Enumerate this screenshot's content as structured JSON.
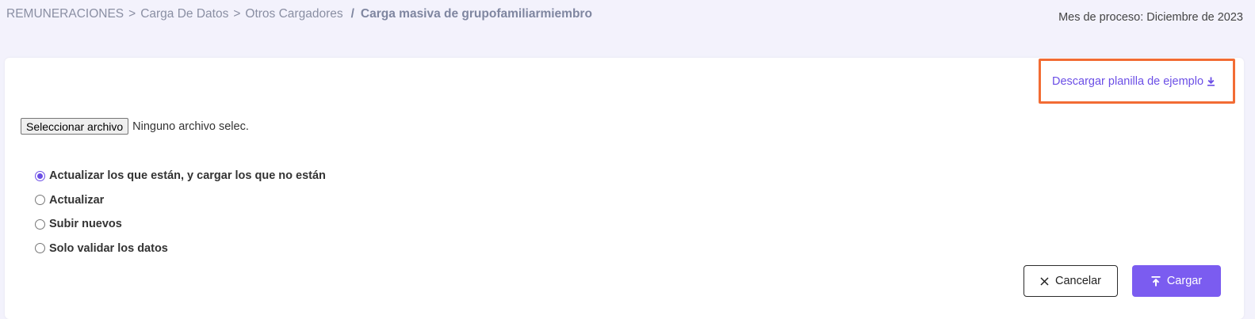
{
  "breadcrumb": {
    "items": [
      "REMUNERACIONES",
      "Carga De Datos",
      "Otros Cargadores"
    ],
    "separators": [
      ">",
      ">",
      "/"
    ],
    "current": "Carga masiva de grupofamiliarmiembro"
  },
  "period": {
    "label": "Mes de proceso: Diciembre de 2023"
  },
  "download": {
    "label": "Descargar planilla de ejemplo",
    "icon": "download-icon",
    "highlight_color": "#f26c34"
  },
  "file_input": {
    "button_label": "Seleccionar archivo",
    "status": "Ninguno archivo selec."
  },
  "options": [
    {
      "label": "Actualizar los que están, y cargar los que no están",
      "checked": true
    },
    {
      "label": "Actualizar",
      "checked": false
    },
    {
      "label": "Subir nuevos",
      "checked": false
    },
    {
      "label": "Solo validar los datos",
      "checked": false
    }
  ],
  "actions": {
    "cancel_label": "Cancelar",
    "cancel_icon": "close-icon",
    "submit_label": "Cargar",
    "submit_icon": "upload-icon",
    "accent": "#7b5cf0"
  }
}
